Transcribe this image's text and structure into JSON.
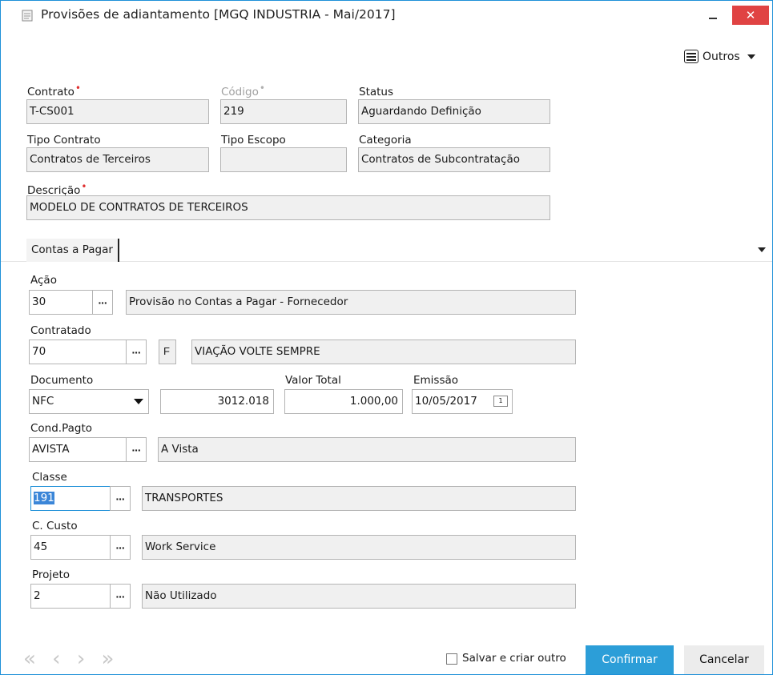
{
  "window": {
    "title": "Provisões de adiantamento [MGQ INDUSTRIA - Mai/2017]",
    "close_glyph": "✕"
  },
  "toolbar": {
    "outros_label": "Outros"
  },
  "header": {
    "contrato": {
      "label": "Contrato",
      "value": "T-CS001"
    },
    "codigo": {
      "label": "Código",
      "value": "219"
    },
    "status": {
      "label": "Status",
      "value": "Aguardando Definição"
    },
    "tipo_contrato": {
      "label": "Tipo Contrato",
      "value": "Contratos de Terceiros"
    },
    "tipo_escopo": {
      "label": "Tipo Escopo",
      "value": ""
    },
    "categoria": {
      "label": "Categoria",
      "value": "Contratos de Subcontratação"
    },
    "descricao": {
      "label": "Descrição",
      "value": "MODELO DE CONTRATOS DE TERCEIROS"
    }
  },
  "tabs": [
    {
      "label": "Contas a Pagar"
    }
  ],
  "form": {
    "acao": {
      "label": "Ação",
      "code": "30",
      "desc": "Provisão no Contas a Pagar - Fornecedor"
    },
    "contratado": {
      "label": "Contratado",
      "code": "70",
      "type": "F",
      "desc": "VIAÇÃO VOLTE SEMPRE"
    },
    "documento": {
      "label": "Documento",
      "value": "NFC",
      "number": "3012.018"
    },
    "valor_total": {
      "label": "Valor Total",
      "value": "1.000,00"
    },
    "emissao": {
      "label": "Emissão",
      "value": "10/05/2017",
      "cal_day": "1"
    },
    "cond_pagto": {
      "label": "Cond.Pagto",
      "code": "AVISTA",
      "desc": "A Vista"
    },
    "classe": {
      "label": "Classe",
      "code": "191",
      "desc": "TRANSPORTES"
    },
    "c_custo": {
      "label": "C. Custo",
      "code": "45",
      "desc": "Work Service"
    },
    "projeto": {
      "label": "Projeto",
      "code": "2",
      "desc": "Não Utilizado"
    }
  },
  "lookup_glyph": "···",
  "required_glyph": "•",
  "footer": {
    "nav": "« ‹ › »",
    "save_and_new_label": "Salvar e criar outro",
    "confirm_label": "Confirmar",
    "cancel_label": "Cancelar"
  }
}
